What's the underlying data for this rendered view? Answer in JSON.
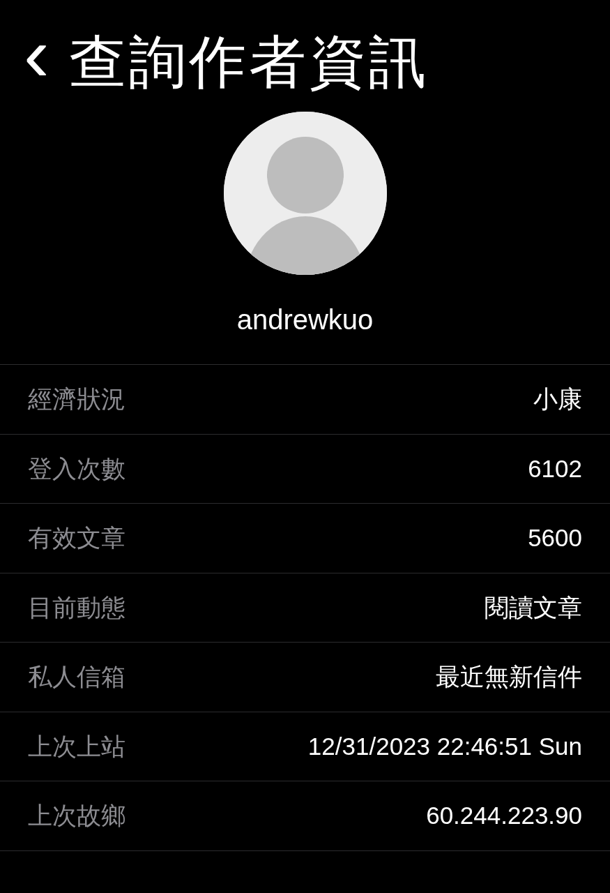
{
  "header": {
    "back": "‹",
    "title": "查詢作者資訊"
  },
  "profile": {
    "username": "andrewkuo"
  },
  "rows": [
    {
      "label": "經濟狀況",
      "value": "小康"
    },
    {
      "label": "登入次數",
      "value": "6102"
    },
    {
      "label": "有效文章",
      "value": "5600"
    },
    {
      "label": "目前動態",
      "value": "閱讀文章"
    },
    {
      "label": "私人信箱",
      "value": "最近無新信件"
    },
    {
      "label": "上次上站",
      "value": "12/31/2023 22:46:51 Sun"
    },
    {
      "label": "上次故鄉",
      "value": "60.244.223.90"
    }
  ]
}
